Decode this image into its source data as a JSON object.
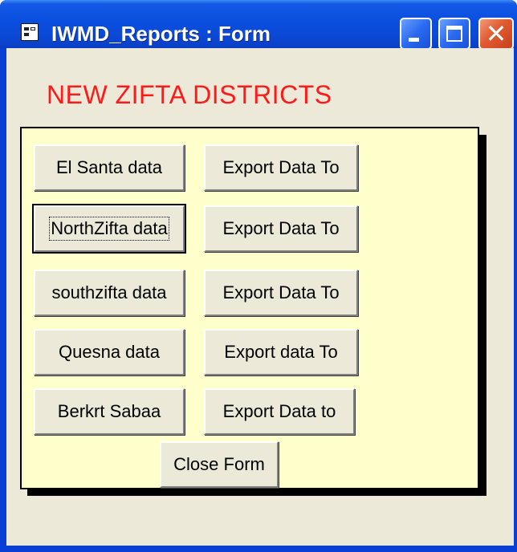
{
  "window": {
    "title": "IWMD_Reports : Form"
  },
  "form": {
    "heading": "NEW ZIFTA DISTRICTS",
    "rows": [
      {
        "data_button": "El Santa data",
        "export_button": "Export Data To"
      },
      {
        "data_button": "NorthZifta data",
        "export_button": "Export Data To"
      },
      {
        "data_button": "southzifta data",
        "export_button": "Export Data To"
      },
      {
        "data_button": "Quesna data",
        "export_button": "Export data To"
      },
      {
        "data_button": "Berkrt Sabaa",
        "export_button": "Export Data to"
      }
    ],
    "close_button": "Close Form",
    "focused_button": "NorthZifta data"
  }
}
